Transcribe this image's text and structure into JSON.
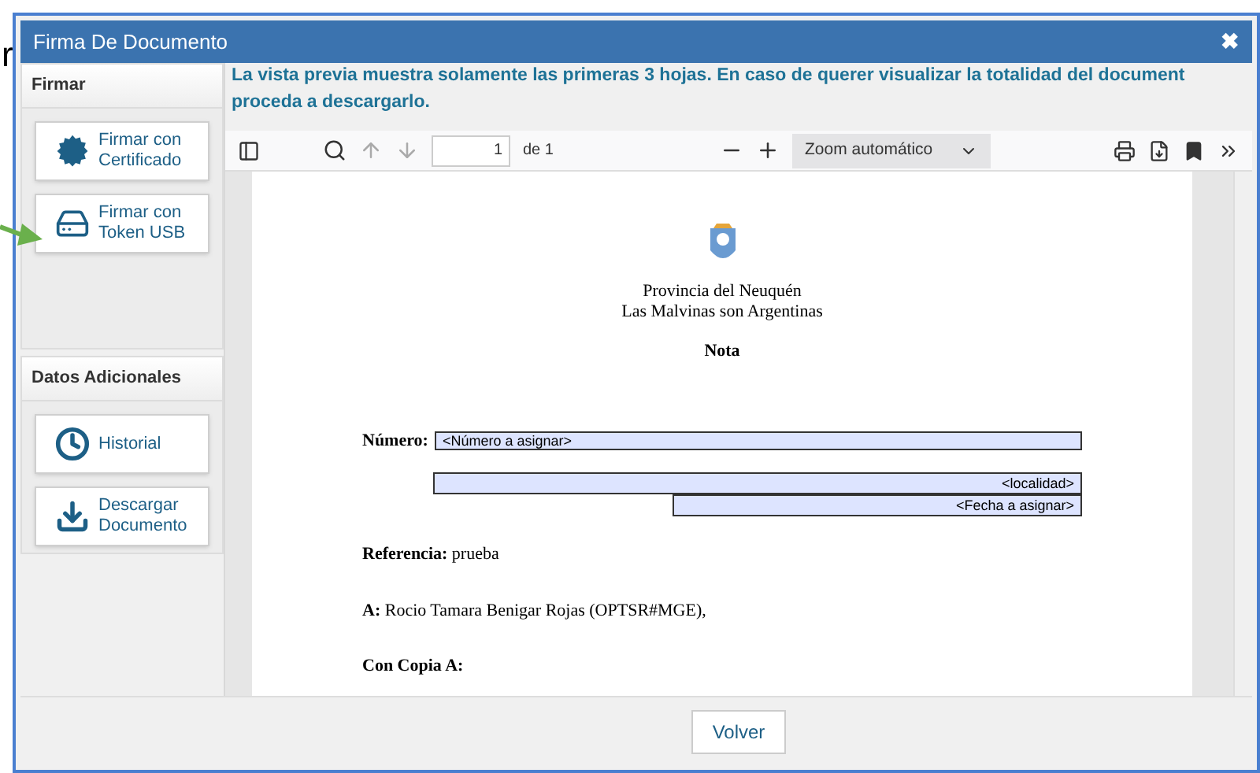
{
  "background_text": "r",
  "window": {
    "title": "Firma De Documento",
    "close": "✖"
  },
  "sidebar": {
    "sections": [
      {
        "title": "Firmar",
        "buttons": [
          {
            "kind": "certificate",
            "label": "Firmar con Certificado"
          },
          {
            "kind": "usb",
            "label": "Firmar con Token USB"
          }
        ]
      },
      {
        "title": "Datos Adicionales",
        "buttons": [
          {
            "kind": "history",
            "label": "Historial"
          },
          {
            "kind": "download",
            "label": "Descargar Documento"
          }
        ]
      }
    ]
  },
  "notice": "La vista previa muestra solamente las primeras 3 hojas. En caso de querer visualizar la totalidad del document proceda a descargarlo.",
  "viewer": {
    "page": "1",
    "page_total": "de 1",
    "zoom": "Zoom automático"
  },
  "document": {
    "header": [
      "Provincia del Neuquén",
      "Las Malvinas son Argentinas"
    ],
    "title": "Nota",
    "numero_label": "Número:",
    "numero": "<Número a asignar>",
    "localidad": "<localidad>",
    "fecha": "<Fecha a asignar>",
    "lines": [
      {
        "label": "Referencia:",
        "value": "prueba"
      },
      {
        "label": "A:",
        "value": "Rocio Tamara Benigar Rojas (OPTSR#MGE),"
      },
      {
        "label": "Con Copia A:"
      }
    ]
  },
  "footer": {
    "button": "Volver"
  }
}
